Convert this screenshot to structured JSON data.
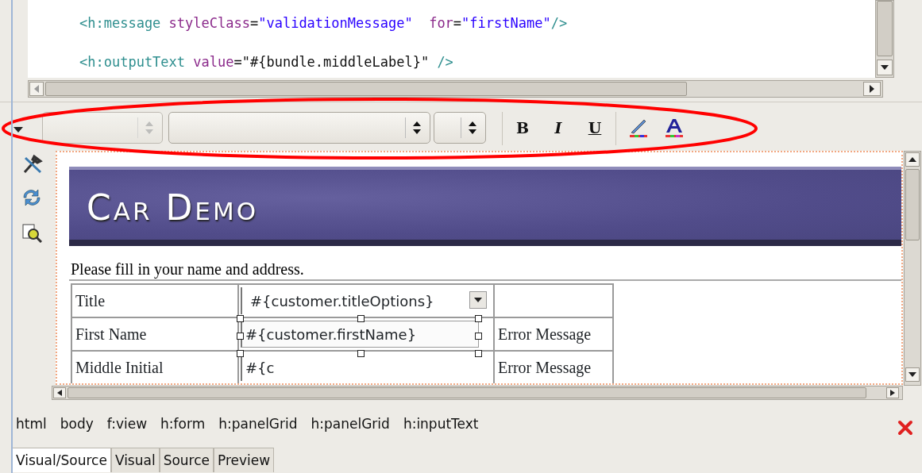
{
  "source_editor": {
    "lines": [
      [
        {
          "kind": "tag",
          "text": "<h:message"
        },
        {
          "kind": "attr",
          "text": " styleClass"
        },
        {
          "kind": "plain",
          "text": "="
        },
        {
          "kind": "value",
          "text": "\"validationMessage\""
        },
        {
          "kind": "attr",
          "text": "  for"
        },
        {
          "kind": "plain",
          "text": "="
        },
        {
          "kind": "value",
          "text": "\"firstName\""
        },
        {
          "kind": "tag",
          "text": "/>"
        }
      ],
      [
        {
          "kind": "tag",
          "text": "<h:outputText"
        },
        {
          "kind": "attr",
          "text": " value"
        },
        {
          "kind": "plain",
          "text": "="
        },
        {
          "kind": "string",
          "text": "\"#{bundle.middleLabel}\""
        },
        {
          "kind": "tag",
          "text": " />"
        }
      ]
    ]
  },
  "toolbar": {
    "combos": [
      {
        "disabled": true
      },
      {
        "disabled": false
      },
      {
        "disabled": false
      }
    ],
    "format_buttons": [
      {
        "kind": "bold",
        "text": "B"
      },
      {
        "kind": "italic",
        "text": "I"
      },
      {
        "kind": "underline",
        "text": "U"
      }
    ]
  },
  "visual_editor": {
    "banner_title": "Car Demo",
    "intro": "Please fill in your name and address.",
    "rows": [
      {
        "label": "Title",
        "kind": "select",
        "value": "#{customer.titleOptions}",
        "error": null,
        "selected": false
      },
      {
        "label": "First Name",
        "kind": "input",
        "value": "#{customer.firstName}",
        "error": "Error Message",
        "selected": true
      },
      {
        "label": "Middle Initial",
        "kind": "input",
        "value": "#{c",
        "error": "Error Message",
        "selected": false
      }
    ]
  },
  "breadcrumbs": [
    "html",
    "body",
    "f:view",
    "h:form",
    "h:panelGrid",
    "h:panelGrid",
    "h:inputText"
  ],
  "tabs": [
    {
      "label": "Visual/Source",
      "selected": true
    },
    {
      "label": "Visual",
      "selected": false
    },
    {
      "label": "Source",
      "selected": false
    },
    {
      "label": "Preview",
      "selected": false
    }
  ]
}
